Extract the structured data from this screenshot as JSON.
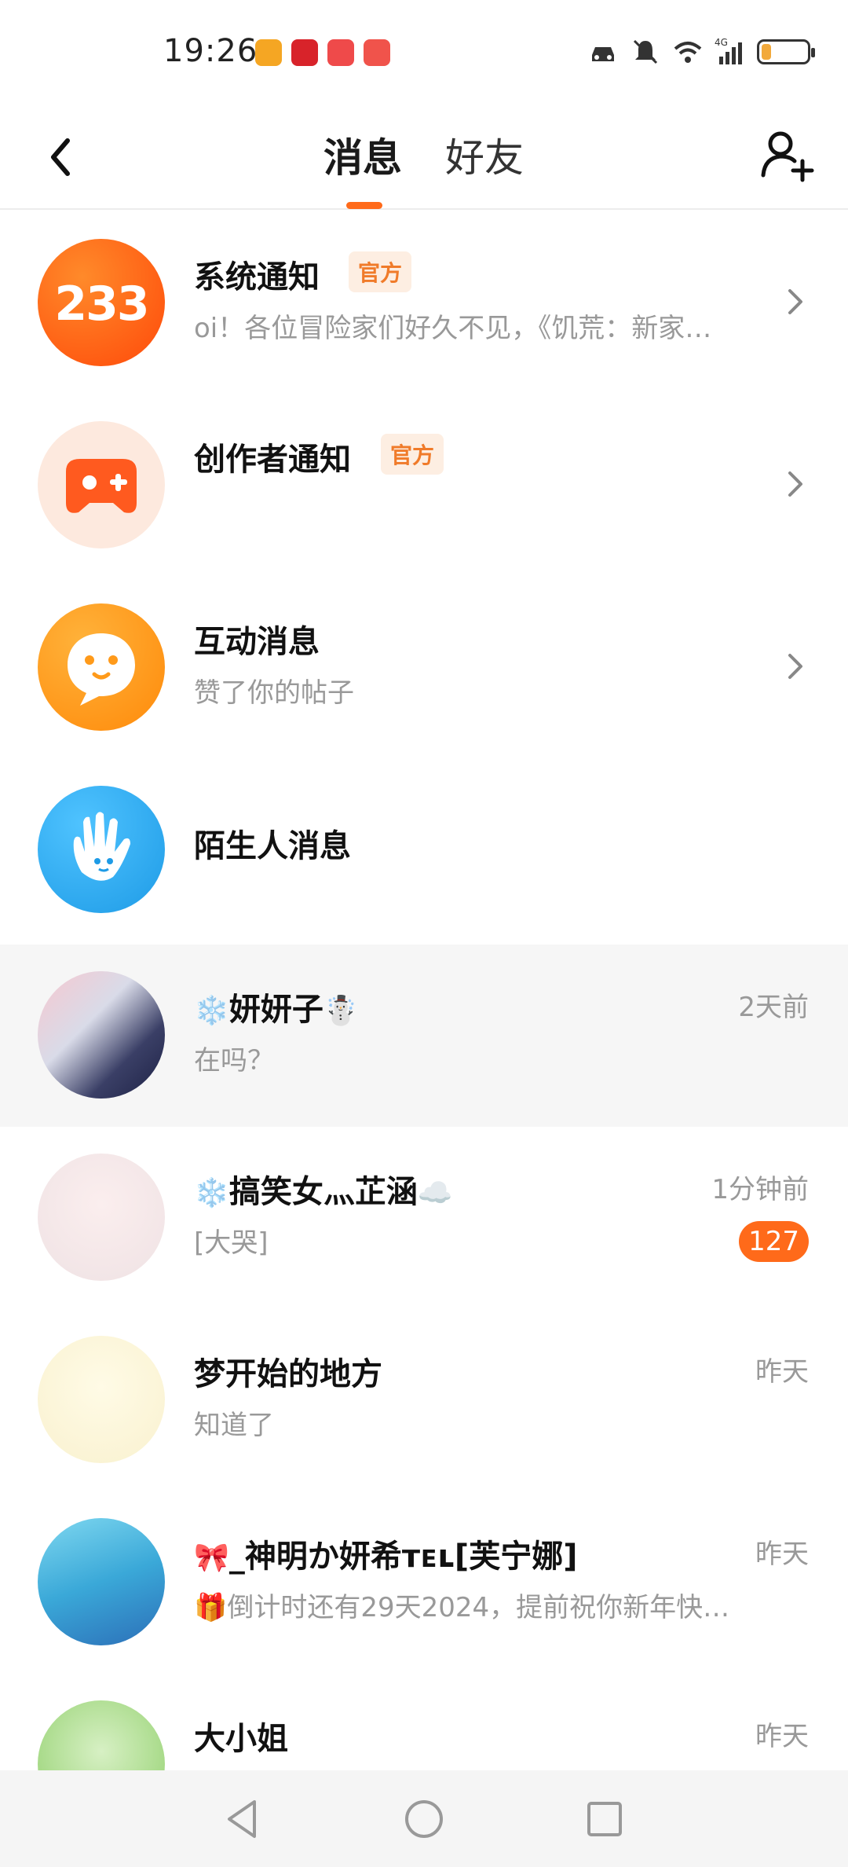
{
  "status_bar": {
    "time": "19:26",
    "network": "4G",
    "notification_apps": [
      "orange-app-icon",
      "red-app-icon",
      "huawei-app-icon",
      "book-app-icon"
    ],
    "icons": [
      "car-icon",
      "mute-bell-icon",
      "wifi-icon",
      "signal-icon",
      "battery-icon"
    ],
    "battery_level": 0.15
  },
  "header": {
    "tabs": [
      {
        "label": "消息",
        "active": true
      },
      {
        "label": "好友",
        "active": false
      }
    ],
    "accent_color": "#ff6a1a"
  },
  "system_rows": [
    {
      "name": "系统通知",
      "tag": "官方",
      "preview": "oi！各位冒险家们好久不见，《饥荒：新家…",
      "avatar": "233-logo"
    },
    {
      "name": "创作者通知",
      "tag": "官方",
      "preview": "",
      "avatar": "gamepad-icon"
    },
    {
      "name": "互动消息",
      "tag": "",
      "preview": "赞了你的帖子",
      "avatar": "chat-bubble-icon"
    },
    {
      "name": "陌生人消息",
      "tag": "",
      "preview": "",
      "avatar": "hand-wave-icon"
    }
  ],
  "chats": [
    {
      "name": "妍妍子",
      "prefix": "❄️",
      "suffix": "☃️",
      "preview": "在吗？",
      "time": "2天前",
      "highlighted": true
    },
    {
      "name": "搞笑女灬芷涵",
      "prefix": "❄️",
      "suffix": "☁️",
      "preview": "[大哭]",
      "time": "1分钟前",
      "badge": "127"
    },
    {
      "name": "梦开始的地方",
      "prefix": "",
      "suffix": "",
      "preview": "知道了",
      "time": "昨天"
    },
    {
      "name": "_神明か妍希ᴛᴇʟ[芙宁娜]",
      "prefix": "🎀",
      "suffix": "",
      "preview": "🎁倒计时还有29天2024，提前祝你新年快…",
      "time": "昨天"
    },
    {
      "name": "大小姐",
      "prefix": "",
      "suffix": "",
      "preview": "",
      "time": "昨天"
    }
  ]
}
